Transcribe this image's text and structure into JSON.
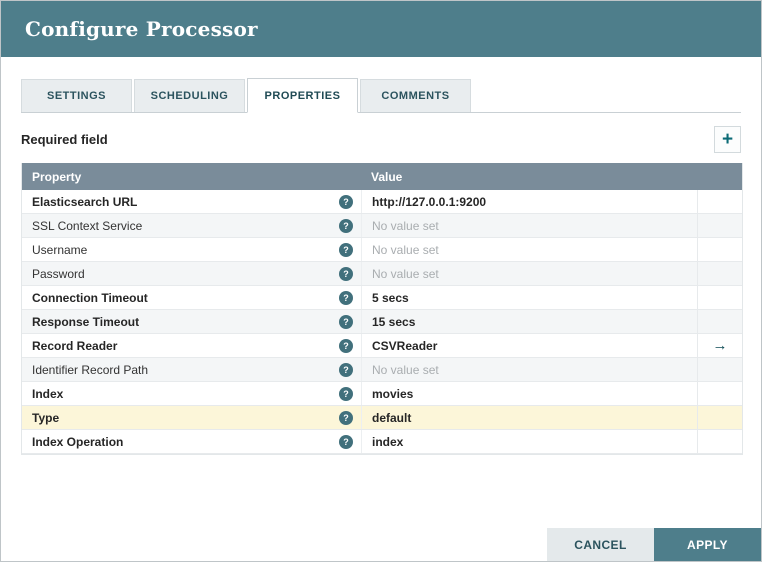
{
  "dialog": {
    "title": "Configure Processor"
  },
  "tabs": [
    {
      "label": "SETTINGS",
      "active": false
    },
    {
      "label": "SCHEDULING",
      "active": false
    },
    {
      "label": "PROPERTIES",
      "active": true
    },
    {
      "label": "COMMENTS",
      "active": false
    }
  ],
  "toolbar": {
    "required_field_label": "Required field"
  },
  "icons": {
    "add_glyph": "+",
    "help_glyph": "?",
    "goto_glyph": "→"
  },
  "table": {
    "header": {
      "property": "Property",
      "value": "Value"
    },
    "rows": [
      {
        "property": "Elasticsearch URL",
        "value": "http://127.0.0.1:9200",
        "required": true,
        "set": true,
        "has_goto": false,
        "highlighted": false
      },
      {
        "property": "SSL Context Service",
        "value": "No value set",
        "required": false,
        "set": false,
        "has_goto": false,
        "highlighted": false
      },
      {
        "property": "Username",
        "value": "No value set",
        "required": false,
        "set": false,
        "has_goto": false,
        "highlighted": false
      },
      {
        "property": "Password",
        "value": "No value set",
        "required": false,
        "set": false,
        "has_goto": false,
        "highlighted": false
      },
      {
        "property": "Connection Timeout",
        "value": "5 secs",
        "required": true,
        "set": true,
        "has_goto": false,
        "highlighted": false
      },
      {
        "property": "Response Timeout",
        "value": "15 secs",
        "required": true,
        "set": true,
        "has_goto": false,
        "highlighted": false
      },
      {
        "property": "Record Reader",
        "value": "CSVReader",
        "required": true,
        "set": true,
        "has_goto": true,
        "highlighted": false
      },
      {
        "property": "Identifier Record Path",
        "value": "No value set",
        "required": false,
        "set": false,
        "has_goto": false,
        "highlighted": false
      },
      {
        "property": "Index",
        "value": "movies",
        "required": true,
        "set": true,
        "has_goto": false,
        "highlighted": false
      },
      {
        "property": "Type",
        "value": "default",
        "required": true,
        "set": true,
        "has_goto": false,
        "highlighted": true
      },
      {
        "property": "Index Operation",
        "value": "index",
        "required": true,
        "set": true,
        "has_goto": false,
        "highlighted": false
      }
    ]
  },
  "footer": {
    "cancel_label": "CANCEL",
    "apply_label": "APPLY"
  },
  "colors": {
    "header_teal": "#4e7e8b",
    "table_header_slate": "#7a8c9a",
    "accent_dark_teal": "#0c4a54",
    "row_alt": "#f4f6f7",
    "row_highlight": "#fcf6d9",
    "unset_text": "#a9adb0"
  }
}
